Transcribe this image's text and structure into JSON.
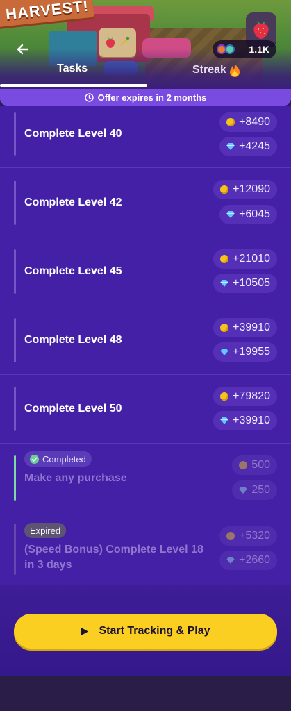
{
  "header": {
    "game_title": "HARVEST!",
    "balance": "1.1K",
    "tabs": [
      {
        "label": "Tasks",
        "active": true
      },
      {
        "label": "Streak",
        "active": false
      }
    ]
  },
  "offer": {
    "text": "Offer expires in 2 months"
  },
  "tasks": [
    {
      "title": "Complete Level 40",
      "coins": "+8490",
      "gems": "+4245",
      "status": "active"
    },
    {
      "title": "Complete Level 42",
      "coins": "+12090",
      "gems": "+6045",
      "status": "active"
    },
    {
      "title": "Complete Level 45",
      "coins": "+21010",
      "gems": "+10505",
      "status": "active"
    },
    {
      "title": "Complete Level 48",
      "coins": "+39910",
      "gems": "+19955",
      "status": "active"
    },
    {
      "title": "Complete Level 50",
      "coins": "+79820",
      "gems": "+39910",
      "status": "active"
    },
    {
      "title": "Make any purchase",
      "coins": "500",
      "gems": "250",
      "status": "completed",
      "badge": "Completed"
    },
    {
      "title_line1": "(Speed Bonus) Complete Level 18",
      "title_line2": "in 3 days",
      "coins": "+5320",
      "gems": "+2660",
      "status": "expired",
      "badge": "Expired"
    }
  ],
  "cta": {
    "label": "Start Tracking & Play"
  },
  "colors": {
    "list_bg": "#4420a6",
    "offer_bar": "#7a4be0",
    "cta": "#fbcf21",
    "coin": "#f6c21c",
    "gem": "#5fc8ff",
    "completed_accent": "#7fd8a8"
  },
  "icons": [
    "back-arrow-icon",
    "currency-chip-icon",
    "strawberry-icon",
    "clock-icon",
    "fire-icon",
    "coin-icon",
    "gem-icon",
    "check-icon",
    "play-icon"
  ]
}
